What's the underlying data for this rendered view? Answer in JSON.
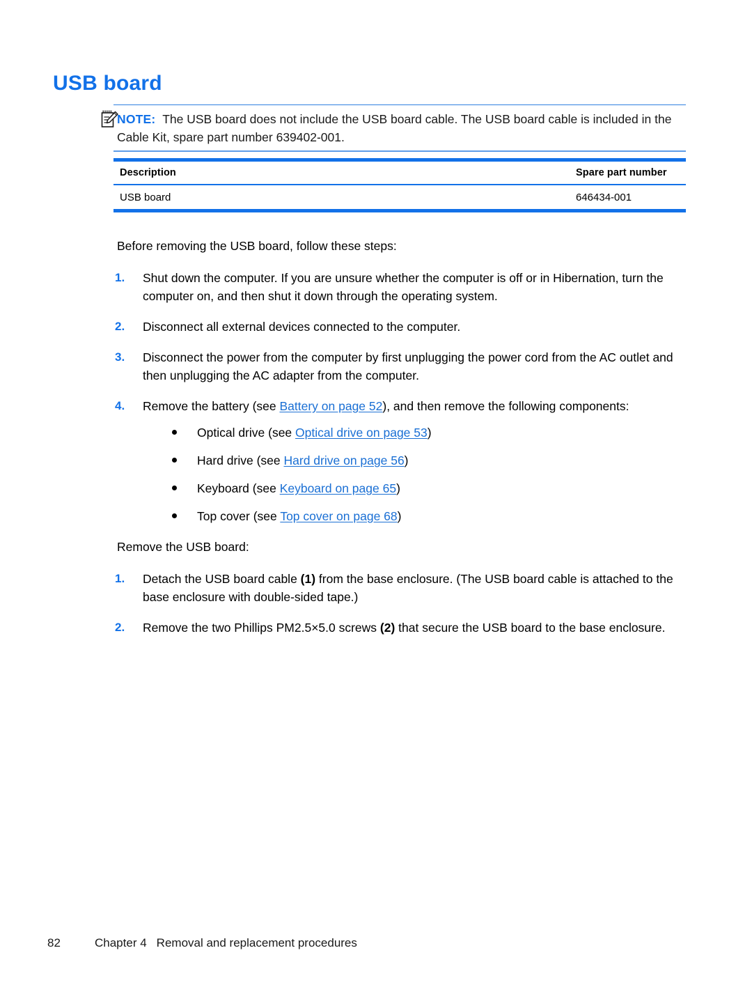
{
  "heading": "USB board",
  "note": {
    "icon": "note-pad-pencil-icon",
    "label": "NOTE:",
    "text": "The USB board does not include the USB board cable. The USB board cable is included in the Cable Kit, spare part number 639402-001."
  },
  "table": {
    "columns": [
      "Description",
      "Spare part number"
    ],
    "rows": [
      {
        "description": "USB board",
        "spare_part_number": "646434-001"
      }
    ]
  },
  "intro": "Before removing the USB board, follow these steps:",
  "presteps": [
    {
      "num": "1.",
      "text": "Shut down the computer. If you are unsure whether the computer is off or in Hibernation, turn the computer on, and then shut it down through the operating system."
    },
    {
      "num": "2.",
      "text": "Disconnect all external devices connected to the computer."
    },
    {
      "num": "3.",
      "text": "Disconnect the power from the computer by first unplugging the power cord from the AC outlet and then unplugging the AC adapter from the computer."
    },
    {
      "num": "4.",
      "lead": "Remove the battery (see ",
      "link": "Battery on page 52",
      "tail": "), and then remove the following components:",
      "bullets": [
        {
          "lead": "Optical drive (see ",
          "link": "Optical drive on page 53",
          "tail": ")"
        },
        {
          "lead": "Hard drive (see ",
          "link": "Hard drive on page 56",
          "tail": ")"
        },
        {
          "lead": "Keyboard (see ",
          "link": "Keyboard on page 65",
          "tail": ")"
        },
        {
          "lead": "Top cover (see ",
          "link": "Top cover on page 68",
          "tail": ")"
        }
      ]
    }
  ],
  "remove_intro": "Remove the USB board:",
  "removesteps": [
    {
      "num": "1.",
      "part1": "Detach the USB board cable ",
      "cue": "(1)",
      "part2": " from the base enclosure. (The USB board cable is attached to the base enclosure with double-sided tape.)"
    },
    {
      "num": "2.",
      "part1": "Remove the two Phillips PM2.5×5.0 screws ",
      "cue": "(2)",
      "part2": " that secure the USB board to the base enclosure."
    }
  ],
  "footer": {
    "page_number": "82",
    "chapter": "Chapter 4",
    "title": "Removal and replacement procedures"
  },
  "colors": {
    "accent_blue": "#1271e8",
    "link_blue": "#1a6fd4"
  }
}
